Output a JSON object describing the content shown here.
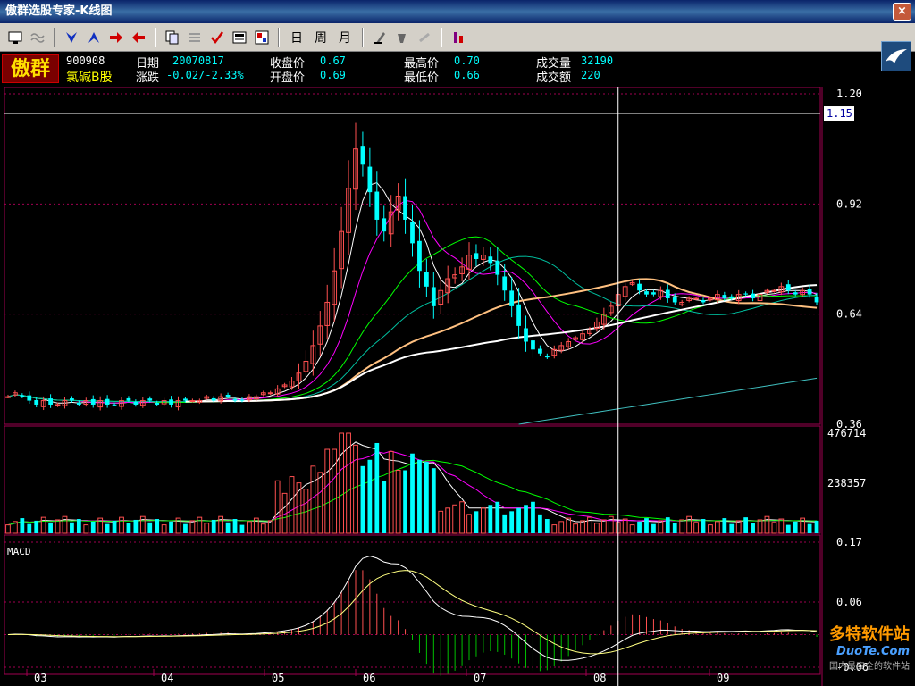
{
  "window": {
    "title": "傲群选股专家-K线图",
    "close_label": "×"
  },
  "toolbar": {
    "day_label": "日",
    "week_label": "周",
    "month_label": "月"
  },
  "stock": {
    "logo_text": "傲群",
    "code": "900908",
    "name": "氯碱B股",
    "date_label": "日期",
    "date": "20070817",
    "change_label": "涨跌",
    "change": "-0.02/-2.33%",
    "close_label": "收盘价",
    "close": "0.67",
    "open_label": "开盘价",
    "open": "0.69",
    "high_label": "最高价",
    "high": "0.70",
    "low_label": "最低价",
    "low": "0.66",
    "volume_label": "成交量",
    "volume": "32190",
    "amount_label": "成交额",
    "amount": "220"
  },
  "colors": {
    "up": "#ff5050",
    "down": "#00ffff",
    "ma5": "#ffffff",
    "ma10": "#ff00ff",
    "ma20": "#00ff00",
    "ma30": "#00c0a0",
    "ma60": "#ffc080",
    "ma120": "#ffffff",
    "ma250": "#40c0c0",
    "grid": "#a00050"
  },
  "chart_data": [
    {
      "type": "candlestick",
      "price_axis": {
        "ticks": [
          "1.20",
          "0.92",
          "0.64",
          "0.36"
        ],
        "ylim": [
          0.36,
          1.2
        ]
      },
      "cursor_price": "1.15",
      "months": [
        "03",
        "04",
        "05",
        "06",
        "07",
        "08",
        "09"
      ],
      "closes": [
        0.43,
        0.44,
        0.43,
        0.42,
        0.41,
        0.42,
        0.41,
        0.41,
        0.42,
        0.42,
        0.41,
        0.42,
        0.41,
        0.42,
        0.41,
        0.41,
        0.42,
        0.42,
        0.41,
        0.42,
        0.42,
        0.41,
        0.42,
        0.41,
        0.42,
        0.42,
        0.42,
        0.42,
        0.43,
        0.42,
        0.43,
        0.43,
        0.42,
        0.42,
        0.43,
        0.43,
        0.44,
        0.44,
        0.45,
        0.46,
        0.47,
        0.49,
        0.52,
        0.56,
        0.61,
        0.67,
        0.75,
        0.85,
        0.96,
        1.06,
        1.02,
        0.95,
        0.88,
        0.85,
        0.9,
        0.94,
        0.88,
        0.82,
        0.75,
        0.71,
        0.66,
        0.7,
        0.73,
        0.74,
        0.76,
        0.79,
        0.78,
        0.79,
        0.77,
        0.74,
        0.7,
        0.66,
        0.61,
        0.57,
        0.55,
        0.54,
        0.53,
        0.55,
        0.56,
        0.57,
        0.58,
        0.59,
        0.6,
        0.62,
        0.64,
        0.66,
        0.69,
        0.71,
        0.72,
        0.7,
        0.69,
        0.69,
        0.7,
        0.68,
        0.67,
        0.67,
        0.68,
        0.68,
        0.67,
        0.68,
        0.69,
        0.68,
        0.68,
        0.69,
        0.69,
        0.68,
        0.69,
        0.7,
        0.7,
        0.71,
        0.7,
        0.69,
        0.7,
        0.69,
        0.67
      ],
      "volume_axis": {
        "ticks": [
          "476714",
          "238357"
        ],
        "ylim": [
          0,
          476714
        ]
      },
      "macd_axis": {
        "ticks": [
          "0.17",
          "0.06",
          "-0.06"
        ],
        "label": "MACD",
        "ylim": [
          -0.06,
          0.17
        ]
      }
    }
  ],
  "watermark": {
    "brand": "多特软件站",
    "url": "DuoTe.Com",
    "subtitle": "国内最安全的软件站"
  }
}
